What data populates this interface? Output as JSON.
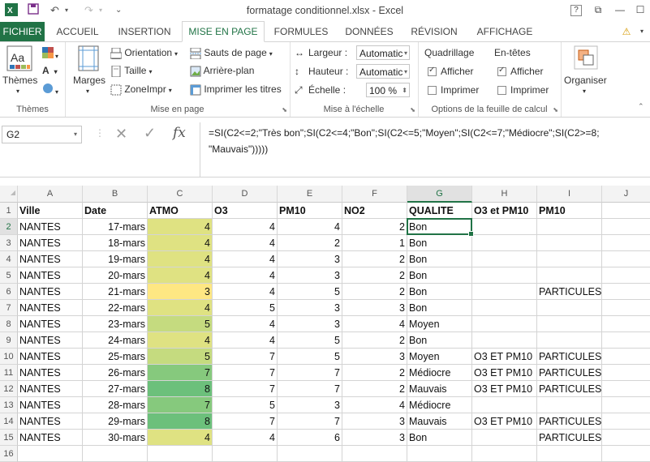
{
  "window": {
    "title": "formatage conditionnel.xlsx - Excel",
    "help": "?"
  },
  "tabs": [
    "FICHIER",
    "ACCUEIL",
    "INSERTION",
    "MISE EN PAGE",
    "FORMULES",
    "DONNÉES",
    "RÉVISION",
    "AFFICHAGE"
  ],
  "ribbon": {
    "themes": {
      "button": "Thèmes",
      "group": "Thèmes"
    },
    "mise_en_page": {
      "marges": "Marges",
      "orientation": "Orientation",
      "taille": "Taille",
      "zone_impr": "ZoneImpr",
      "sauts": "Sauts de page",
      "arriere_plan": "Arrière-plan",
      "imprimer_titres": "Imprimer les titres",
      "group": "Mise en page"
    },
    "echelle": {
      "largeur_label": "Largeur :",
      "largeur_value": "Automatic",
      "hauteur_label": "Hauteur :",
      "hauteur_value": "Automatic",
      "echelle_label": "Échelle :",
      "echelle_value": "100 %",
      "group": "Mise à l'échelle"
    },
    "options": {
      "quadrillage": "Quadrillage",
      "entetes": "En-têtes",
      "afficher": "Afficher",
      "imprimer": "Imprimer",
      "group": "Options de la feuille de calcul"
    },
    "organiser": {
      "button": "Organiser"
    }
  },
  "formula_bar": {
    "name_box": "G2",
    "formula": "=SI(C2<=2;\"Très bon\";SI(C2<=4;\"Bon\";SI(C2<=5;\"Moyen\";SI(C2<=7;\"Médiocre\";SI(C2>=8;\n\"Mauvais\")))))"
  },
  "columns": [
    "A",
    "B",
    "C",
    "D",
    "E",
    "F",
    "G",
    "H",
    "I",
    "J"
  ],
  "headers": [
    "Ville",
    "Date",
    "ATMO",
    "O3",
    "PM10",
    "NO2",
    "QUALITE",
    "O3 et PM10",
    "PM10"
  ],
  "rows": [
    [
      "NANTES",
      "17-mars",
      "4",
      "4",
      "4",
      "2",
      "Bon",
      "",
      ""
    ],
    [
      "NANTES",
      "18-mars",
      "4",
      "4",
      "2",
      "1",
      "Bon",
      "",
      ""
    ],
    [
      "NANTES",
      "19-mars",
      "4",
      "4",
      "3",
      "2",
      "Bon",
      "",
      ""
    ],
    [
      "NANTES",
      "20-mars",
      "4",
      "4",
      "3",
      "2",
      "Bon",
      "",
      ""
    ],
    [
      "NANTES",
      "21-mars",
      "3",
      "4",
      "5",
      "2",
      "Bon",
      "",
      "PARTICULES"
    ],
    [
      "NANTES",
      "22-mars",
      "4",
      "5",
      "3",
      "3",
      "Bon",
      "",
      ""
    ],
    [
      "NANTES",
      "23-mars",
      "5",
      "4",
      "3",
      "4",
      "Moyen",
      "",
      ""
    ],
    [
      "NANTES",
      "24-mars",
      "4",
      "4",
      "5",
      "2",
      "Bon",
      "",
      ""
    ],
    [
      "NANTES",
      "25-mars",
      "5",
      "7",
      "5",
      "3",
      "Moyen",
      "O3 ET PM10",
      "PARTICULES"
    ],
    [
      "NANTES",
      "26-mars",
      "7",
      "7",
      "7",
      "2",
      "Médiocre",
      "O3 ET PM10",
      "PARTICULES"
    ],
    [
      "NANTES",
      "27-mars",
      "8",
      "7",
      "7",
      "2",
      "Mauvais",
      "O3 ET PM10",
      "PARTICULES"
    ],
    [
      "NANTES",
      "28-mars",
      "7",
      "5",
      "3",
      "4",
      "Médiocre",
      "",
      ""
    ],
    [
      "NANTES",
      "29-mars",
      "8",
      "7",
      "7",
      "3",
      "Mauvais",
      "O3 ET PM10",
      "PARTICULES"
    ],
    [
      "NANTES",
      "30-mars",
      "4",
      "4",
      "6",
      "3",
      "Bon",
      "",
      "PARTICULES"
    ]
  ],
  "row_numbers": [
    "1",
    "2",
    "3",
    "4",
    "5",
    "6",
    "7",
    "8",
    "9",
    "10",
    "11",
    "12",
    "13",
    "14",
    "15",
    "16"
  ],
  "colors": {
    "excel_green": "#217346",
    "atmo_scale": {
      "3": "#fee783",
      "4": "#dfe282",
      "5": "#c5db7f",
      "7": "#86c97d",
      "8": "#6cc07b"
    }
  }
}
